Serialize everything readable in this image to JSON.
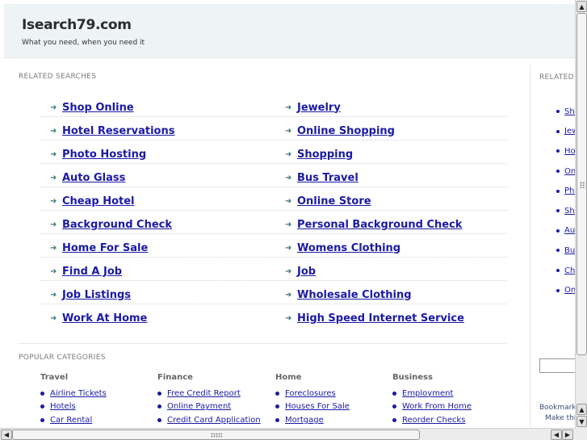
{
  "header": {
    "title": "Isearch79.com",
    "tagline": "What you need, when you need it"
  },
  "related_searches": {
    "label": "RELATED SEARCHES",
    "rows": [
      [
        "Shop Online",
        "Jewelry"
      ],
      [
        "Hotel Reservations",
        "Online Shopping"
      ],
      [
        "Photo Hosting",
        "Shopping"
      ],
      [
        "Auto Glass",
        "Bus Travel"
      ],
      [
        "Cheap Hotel",
        "Online Store"
      ],
      [
        "Background Check",
        "Personal Background Check"
      ],
      [
        "Home For Sale",
        "Womens Clothing"
      ],
      [
        "Find A Job",
        "Job"
      ],
      [
        "Job Listings",
        "Wholesale Clothing"
      ],
      [
        "Work At Home",
        "High Speed Internet Service"
      ]
    ]
  },
  "popular_categories": {
    "label": "POPULAR CATEGORIES",
    "columns": [
      {
        "title": "Travel",
        "items": [
          "Airline Tickets",
          "Hotels",
          "Car Rental"
        ]
      },
      {
        "title": "Finance",
        "items": [
          "Free Credit Report",
          "Online Payment",
          "Credit Card Application"
        ]
      },
      {
        "title": "Home",
        "items": [
          "Foreclosures",
          "Houses For Sale",
          "Mortgage"
        ]
      },
      {
        "title": "Business",
        "items": [
          "Employment",
          "Work From Home",
          "Reorder Checks"
        ]
      }
    ]
  },
  "sidebar": {
    "label": "RELATED",
    "items": [
      "Sho",
      "Jew",
      "Ho",
      "On",
      "Pho",
      "Sho",
      "Aut",
      "Bus",
      "Ch",
      "On"
    ],
    "bookmark_line1": "Bookmark",
    "bookmark_line2": "Make thi"
  },
  "colors": {
    "link": "#1a1aa6",
    "header_bg": "#eef3f6",
    "arrow": "#3a7a76"
  },
  "icons": {
    "link_arrow": "arrow-right-icon",
    "scroll_up": "triangle-up-icon",
    "scroll_down": "triangle-down-icon",
    "scroll_left": "triangle-left-icon",
    "scroll_right": "triangle-right-icon"
  }
}
